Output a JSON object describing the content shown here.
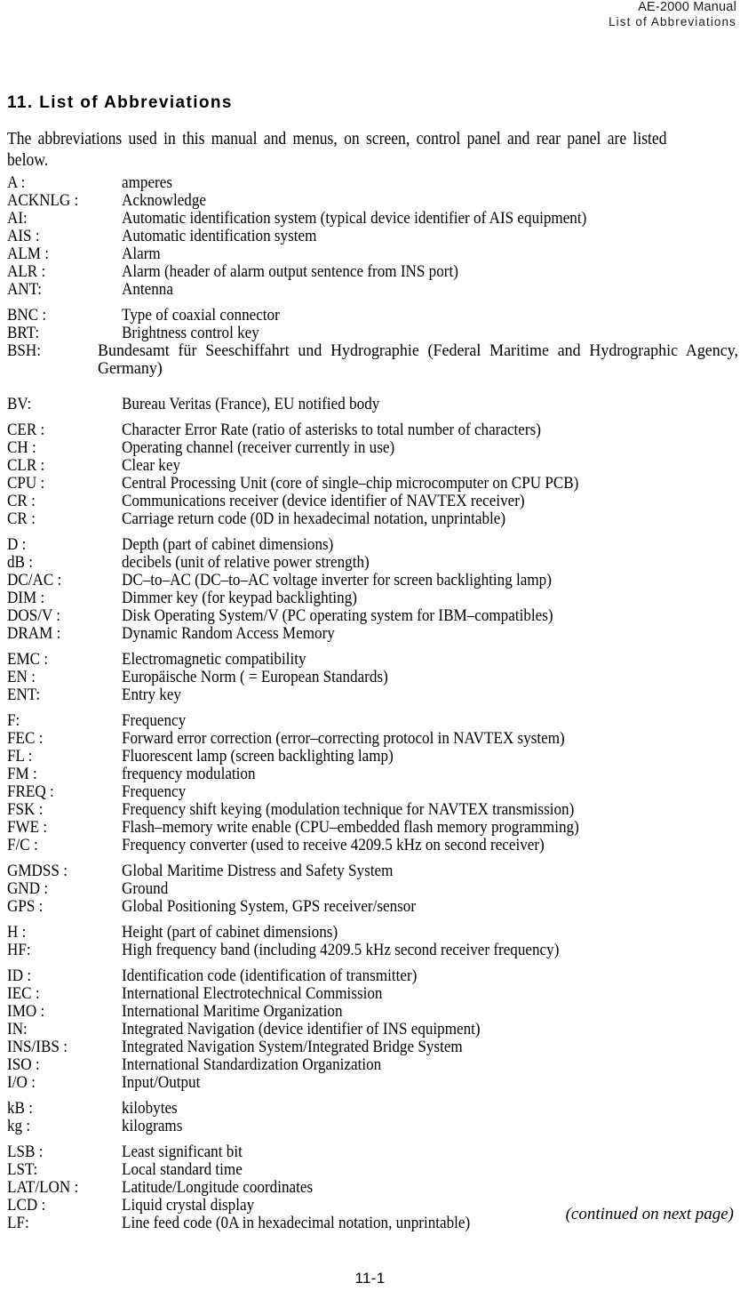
{
  "header": {
    "line1": "AE-2000 Manual",
    "line2": "List of Abbreviations"
  },
  "section": {
    "title": "11.  List of Abbreviations",
    "intro": "The abbreviations used in this manual and menus, on screen, control panel and rear panel are listed below."
  },
  "groups": [
    {
      "id": "group-a",
      "entries": [
        {
          "abbr": "A :",
          "definition": "amperes"
        },
        {
          "abbr": "ACKNLG :",
          "definition": "Acknowledge"
        },
        {
          "abbr": "AI:",
          "definition": "Automatic identification system (typical device identifier of AIS equipment)"
        },
        {
          "abbr": "AIS :",
          "definition": "Automatic identification system"
        },
        {
          "abbr": "ALM :",
          "definition": "Alarm"
        },
        {
          "abbr": "ALR :",
          "definition": "Alarm (header of alarm output sentence from INS port)"
        },
        {
          "abbr": "ANT:",
          "definition": "Antenna"
        }
      ]
    },
    {
      "id": "group-b",
      "entries": [
        {
          "abbr": "BNC :",
          "definition": "Type of coaxial connector"
        },
        {
          "abbr": "BRT:",
          "definition": "Brightness control key"
        },
        {
          "abbr": "BSH:",
          "definition": "Bundesamt für Seeschiffahrt und Hydrographie (Federal Maritime and Hydrographic Agency, Germany)",
          "wrap": true
        },
        {
          "abbr": "BV:",
          "definition": "Bureau Veritas (France), EU notified body"
        }
      ]
    },
    {
      "id": "group-c",
      "entries": [
        {
          "abbr": "CER :",
          "definition": "Character Error Rate (ratio of asterisks to total number of characters)"
        },
        {
          "abbr": "CH :",
          "definition": "Operating channel (receiver currently in use)"
        },
        {
          "abbr": "CLR :",
          "definition": "Clear key"
        },
        {
          "abbr": "CPU :",
          "definition": "Central Processing Unit (core of single–chip microcomputer on CPU PCB)"
        },
        {
          "abbr": "CR :",
          "definition": "Communications receiver (device identifier of NAVTEX receiver)"
        },
        {
          "abbr": "CR :",
          "definition": "Carriage return code (0D in hexadecimal notation, unprintable)"
        }
      ]
    },
    {
      "id": "group-d",
      "entries": [
        {
          "abbr": "D :",
          "definition": "Depth (part of cabinet dimensions)"
        },
        {
          "abbr": "dB :",
          "definition": "decibels (unit of relative power strength)"
        },
        {
          "abbr": "DC/AC :",
          "definition": "DC–to–AC (DC–to–AC voltage inverter for screen backlighting lamp)"
        },
        {
          "abbr": "DIM :",
          "definition": "Dimmer key (for keypad backlighting)"
        },
        {
          "abbr": "DOS/V :",
          "definition": "Disk Operating System/V (PC operating system for IBM–compatibles)"
        },
        {
          "abbr": "DRAM :",
          "definition": "Dynamic Random Access Memory"
        }
      ]
    },
    {
      "id": "group-e",
      "entries": [
        {
          "abbr": "EMC :",
          "definition": "Electromagnetic compatibility"
        },
        {
          "abbr": "EN :",
          "definition": "Europäische Norm ( = European Standards)"
        },
        {
          "abbr": "ENT:",
          "definition": "Entry key"
        }
      ]
    },
    {
      "id": "group-f",
      "entries": [
        {
          "abbr": "F:",
          "definition": "Frequency"
        },
        {
          "abbr": "FEC :",
          "definition": "Forward error correction (error–correcting protocol in NAVTEX system)"
        },
        {
          "abbr": "FL :",
          "definition": "Fluorescent lamp (screen backlighting lamp)"
        },
        {
          "abbr": "FM :",
          "definition": "frequency modulation"
        },
        {
          "abbr": "FREQ :",
          "definition": "Frequency"
        },
        {
          "abbr": "FSK :",
          "definition": "Frequency shift keying (modulation technique for NAVTEX transmission)"
        },
        {
          "abbr": "FWE :",
          "definition": "Flash–memory write enable (CPU–embedded flash memory programming)"
        },
        {
          "abbr": "F/C :",
          "definition": "Frequency converter (used to receive 4209.5 kHz on second receiver)"
        }
      ]
    },
    {
      "id": "group-g",
      "entries": [
        {
          "abbr": "GMDSS :",
          "definition": "Global Maritime Distress and Safety System"
        },
        {
          "abbr": "GND :",
          "definition": "Ground"
        },
        {
          "abbr": "GPS :",
          "definition": "Global Positioning System, GPS receiver/sensor"
        }
      ]
    },
    {
      "id": "group-h",
      "entries": [
        {
          "abbr": "H :",
          "definition": "Height (part of cabinet dimensions)"
        },
        {
          "abbr": "HF:",
          "definition": "High frequency band (including 4209.5 kHz second receiver frequency)"
        }
      ]
    },
    {
      "id": "group-i",
      "entries": [
        {
          "abbr": "ID :",
          "definition": "Identification code (identification of transmitter)"
        },
        {
          "abbr": "IEC :",
          "definition": "International Electrotechnical Commission"
        },
        {
          "abbr": "IMO :",
          "definition": "International Maritime Organization"
        },
        {
          "abbr": "IN:",
          "definition": "Integrated Navigation (device identifier of INS equipment)"
        },
        {
          "abbr": "INS/IBS :",
          "definition": "Integrated Navigation System/Integrated Bridge System"
        },
        {
          "abbr": "ISO :",
          "definition": "International Standardization Organization"
        },
        {
          "abbr": "I/O :",
          "definition": "Input/Output"
        }
      ]
    },
    {
      "id": "group-k",
      "entries": [
        {
          "abbr": "kB :",
          "definition": "kilobytes"
        },
        {
          "abbr": "kg :",
          "definition": "kilograms"
        }
      ]
    },
    {
      "id": "group-l",
      "entries": [
        {
          "abbr": "LSB :",
          "definition": "Least significant bit"
        },
        {
          "abbr": "LST:",
          "definition": "Local standard time"
        },
        {
          "abbr": "LAT/LON :",
          "definition": "Latitude/Longitude coordinates"
        },
        {
          "abbr": "LCD :",
          "definition": "Liquid crystal display"
        },
        {
          "abbr": "LF:",
          "definition": "Line feed code (0A in hexadecimal notation, unprintable)"
        }
      ]
    }
  ],
  "footer": {
    "continued": "(continued on next page)",
    "page_number": "11-1"
  }
}
